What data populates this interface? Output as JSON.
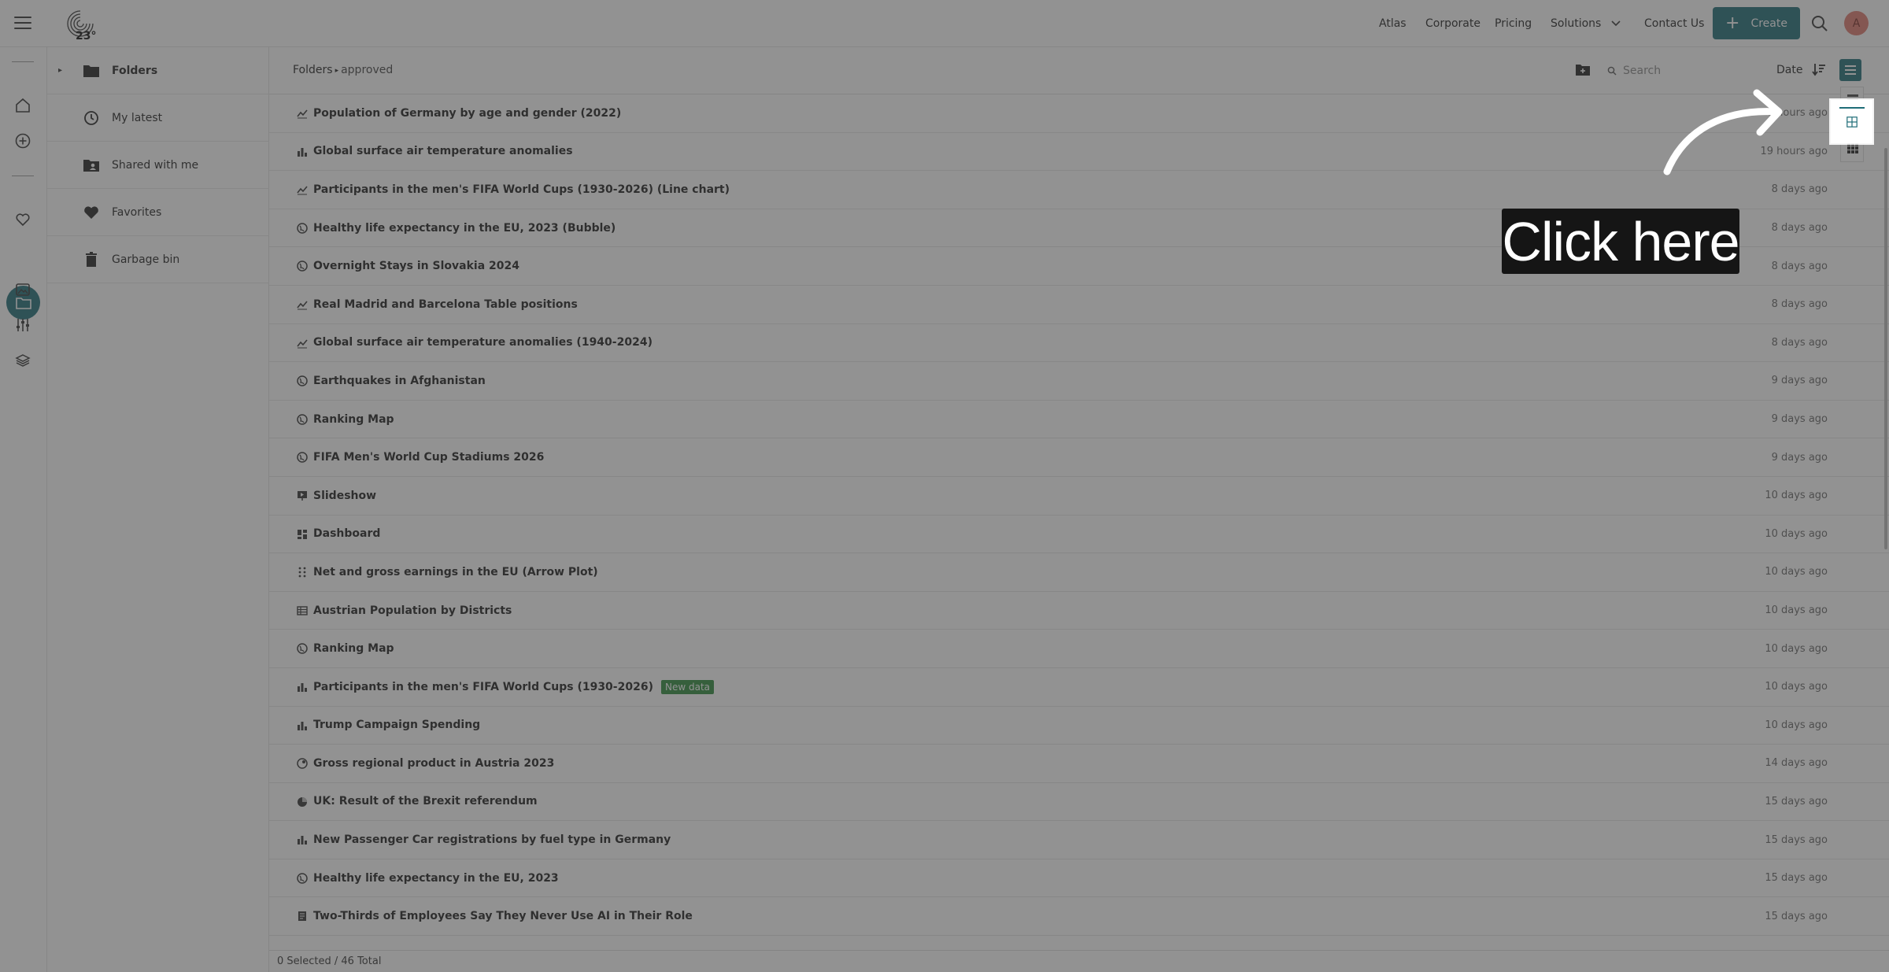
{
  "header": {
    "logo_text": "23°",
    "nav": [
      "Atlas",
      "Corporate",
      "Pricing",
      "Solutions",
      "Contact Us"
    ],
    "create_label": "Create",
    "avatar_initial": "A",
    "accent_color": "#1f6d78"
  },
  "sidebar": {
    "items": [
      {
        "label": "Folders",
        "icon": "folder-icon"
      },
      {
        "label": "My latest",
        "icon": "clock-icon"
      },
      {
        "label": "Shared with me",
        "icon": "shared-folder-icon"
      },
      {
        "label": "Favorites",
        "icon": "heart-icon"
      },
      {
        "label": "Garbage bin",
        "icon": "trash-icon"
      }
    ]
  },
  "toolbar": {
    "breadcrumb_root": "Folders",
    "breadcrumb_current": "approved",
    "search_placeholder": "Search",
    "sort_label": "Date"
  },
  "rows": [
    {
      "title": "Population of Germany by age and gender (2022)",
      "date": "7 hours ago",
      "icon": "line-chart-icon"
    },
    {
      "title": "Global surface air temperature anomalies",
      "date": "19 hours ago",
      "icon": "bar-chart-icon"
    },
    {
      "title": "Participants in the men's FIFA World Cups (1930-2026) (Line chart)",
      "date": "8 days ago",
      "icon": "line-chart-icon"
    },
    {
      "title": "Healthy life expectancy in the EU, 2023 (Bubble)",
      "date": "8 days ago",
      "icon": "globe-icon"
    },
    {
      "title": "Overnight Stays in Slovakia 2024",
      "date": "8 days ago",
      "icon": "globe-icon"
    },
    {
      "title": "Real Madrid and Barcelona Table positions",
      "date": "8 days ago",
      "icon": "line-chart-icon"
    },
    {
      "title": "Global surface air temperature anomalies (1940-2024)",
      "date": "8 days ago",
      "icon": "line-chart-icon"
    },
    {
      "title": "Earthquakes in Afghanistan",
      "date": "9 days ago",
      "icon": "globe-icon"
    },
    {
      "title": "Ranking Map",
      "date": "9 days ago",
      "icon": "globe-icon"
    },
    {
      "title": "FIFA Men's World Cup Stadiums 2026",
      "date": "9 days ago",
      "icon": "globe-icon"
    },
    {
      "title": "Slideshow",
      "date": "10 days ago",
      "icon": "slideshow-icon"
    },
    {
      "title": "Dashboard",
      "date": "10 days ago",
      "icon": "dashboard-icon"
    },
    {
      "title": "Net and gross earnings in the EU (Arrow Plot)",
      "date": "10 days ago",
      "icon": "arrow-plot-icon"
    },
    {
      "title": "Austrian Population by Districts",
      "date": "10 days ago",
      "icon": "table-icon"
    },
    {
      "title": "Ranking Map",
      "date": "10 days ago",
      "icon": "globe-icon"
    },
    {
      "title": "Participants in the men's FIFA World Cups (1930-2026)",
      "date": "10 days ago",
      "icon": "bar-chart-icon",
      "badge": "New data"
    },
    {
      "title": "Trump Campaign Spending",
      "date": "10 days ago",
      "icon": "bar-chart-icon"
    },
    {
      "title": "Gross regional product in Austria 2023",
      "date": "14 days ago",
      "icon": "globe-pin-icon"
    },
    {
      "title": "UK: Result of the Brexit referendum",
      "date": "15 days ago",
      "icon": "pie-chart-icon"
    },
    {
      "title": "New Passenger Car registrations by fuel type in Germany",
      "date": "15 days ago",
      "icon": "bar-chart-icon"
    },
    {
      "title": "Healthy life expectancy in the EU, 2023",
      "date": "15 days ago",
      "icon": "globe-icon"
    },
    {
      "title": "Two-Thirds of Employees Say They Never Use AI in Their Role",
      "date": "15 days ago",
      "icon": "document-icon"
    }
  ],
  "footer": {
    "selection_status": "0 Selected / 46 Total"
  },
  "tutorial": {
    "callout_text": "Click here"
  }
}
